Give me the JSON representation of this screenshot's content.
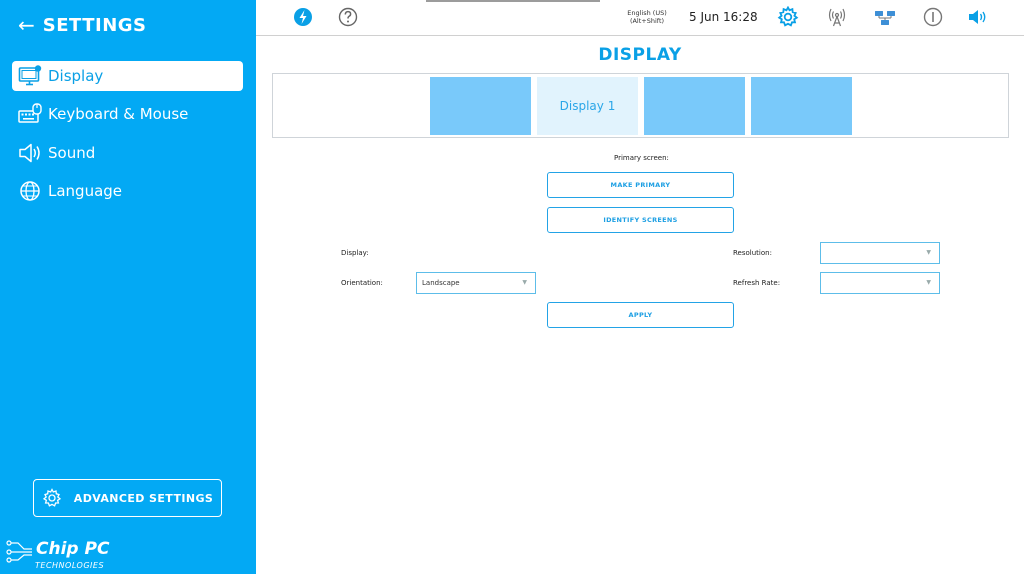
{
  "sidebar": {
    "back_icon": "arrow-left-icon",
    "title": "SETTINGS",
    "items": [
      {
        "label": "Display",
        "icon": "monitor-icon",
        "active": true
      },
      {
        "label": "Keyboard & Mouse",
        "icon": "keyboard-mouse-icon",
        "active": false
      },
      {
        "label": "Sound",
        "icon": "speaker-icon",
        "active": false
      },
      {
        "label": "Language",
        "icon": "globe-icon",
        "active": false
      }
    ],
    "advanced_label": "ADVANCED SETTINGS",
    "logo_name": "Chip PC",
    "logo_sub": "TECHNOLOGIES"
  },
  "topbar": {
    "language_line1": "English (US)",
    "language_line2": "(Alt+Shift)",
    "datetime": "5 Jun 16:28",
    "icons": [
      "lightning-icon",
      "help-icon",
      "gear-icon",
      "wireless-icon",
      "network-icon",
      "power-icon",
      "volume-icon"
    ]
  },
  "main": {
    "title": "DISPLAY",
    "screens": [
      {
        "label": ""
      },
      {
        "label": "Display 1"
      },
      {
        "label": ""
      },
      {
        "label": ""
      }
    ],
    "primary_label": "Primary screen:",
    "make_primary": "MAKE PRIMARY",
    "identify": "IDENTIFY SCREENS",
    "display_label": "Display:",
    "orientation_label": "Orientation:",
    "orientation_value": "Landscape",
    "resolution_label": "Resolution:",
    "resolution_value": "",
    "refresh_label": "Refresh Rate:",
    "refresh_value": "",
    "apply": "APPLY"
  },
  "colors": {
    "accent": "#03a9f4",
    "screen": "#79c9fa",
    "screen_selected": "#e1f3fd"
  }
}
